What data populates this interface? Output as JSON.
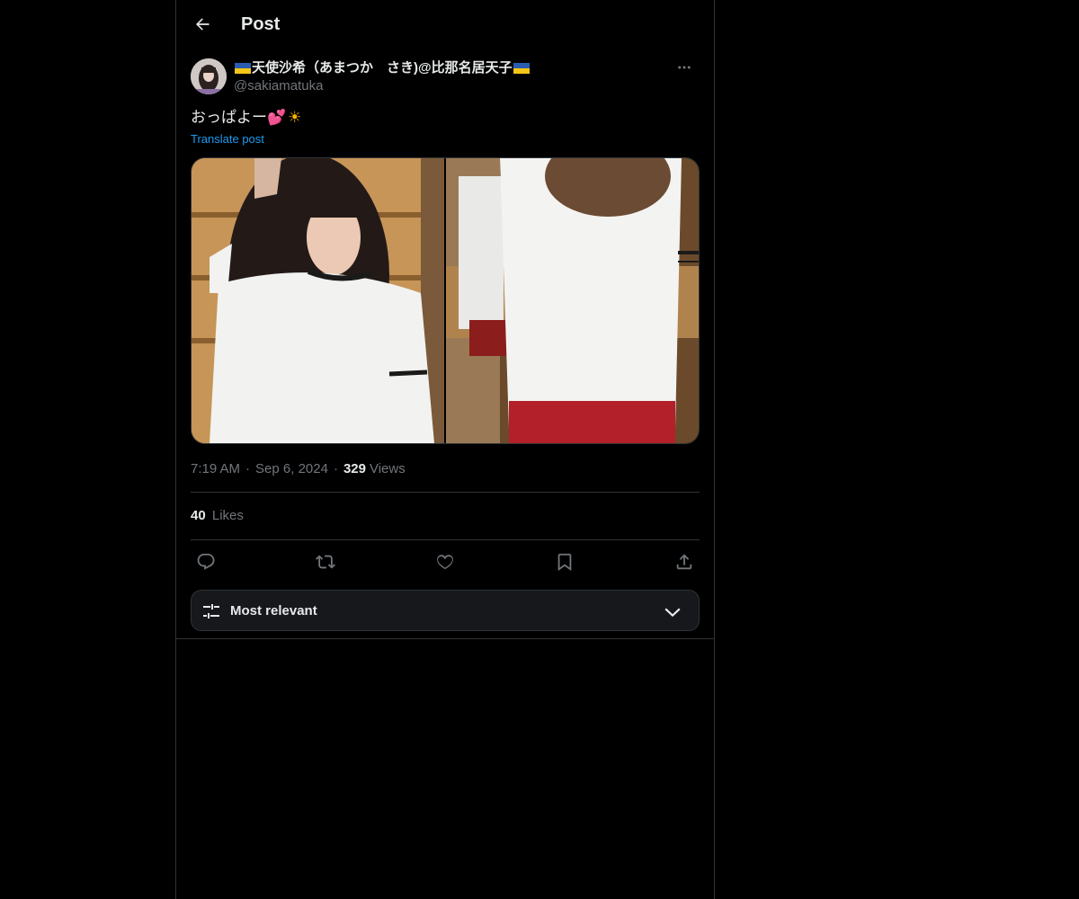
{
  "header": {
    "title": "Post"
  },
  "post": {
    "author": {
      "display_name": "天使沙希（あまつか　さき)@比那名居天子",
      "handle": "@sakiamatuka",
      "flag_color_top": "#2a5db0",
      "flag_color_bottom": "#f5c518"
    },
    "text": "おっぱよー",
    "emoji_1": "💕",
    "emoji_2": "☀",
    "translate_label": "Translate post",
    "time": "7:19 AM",
    "date": "Sep 6, 2024",
    "views_count": "329",
    "views_label": "Views",
    "likes_count": "40",
    "likes_label": "Likes"
  },
  "actions": {
    "reply_icon": "reply-icon",
    "repost_icon": "repost-icon",
    "like_icon": "heart-icon",
    "bookmark_icon": "bookmark-icon",
    "share_icon": "share-icon"
  },
  "sort": {
    "label": "Most relevant"
  },
  "colors": {
    "background": "#000000",
    "border": "#2f3336",
    "text_primary": "#e7e9ea",
    "text_secondary": "#71767b",
    "link": "#1d9bf0",
    "sort_bg": "#16181c"
  }
}
